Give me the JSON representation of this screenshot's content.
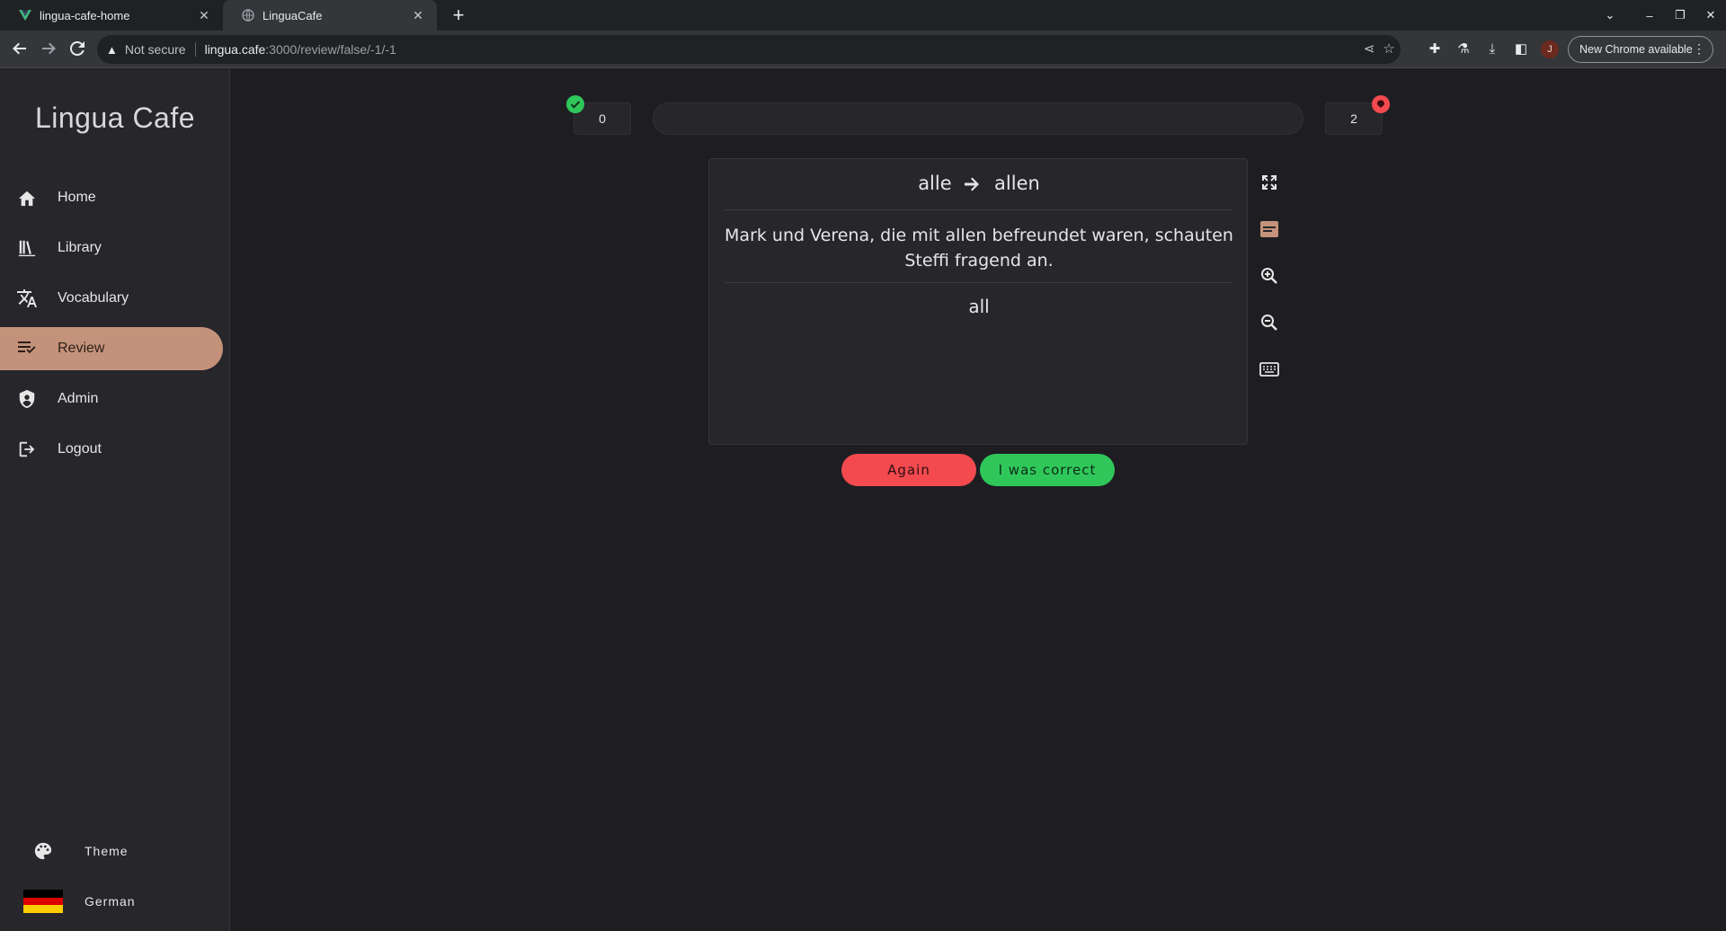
{
  "browser": {
    "tabs": [
      {
        "title": "lingua-cafe-home",
        "active": false
      },
      {
        "title": "LinguaCafe",
        "active": true
      }
    ],
    "security_label": "Not secure",
    "url_host": "lingua.cafe",
    "url_path": ":3000/review/false/-1/-1",
    "profile_initial": "J",
    "update_button": "New Chrome available"
  },
  "sidebar": {
    "brand": "Lingua Cafe",
    "items": [
      {
        "label": "Home",
        "icon": "home-icon",
        "active": false
      },
      {
        "label": "Library",
        "icon": "library-icon",
        "active": false
      },
      {
        "label": "Vocabulary",
        "icon": "translate-icon",
        "active": false
      },
      {
        "label": "Review",
        "icon": "review-icon",
        "active": true
      },
      {
        "label": "Admin",
        "icon": "shield-icon",
        "active": false
      },
      {
        "label": "Logout",
        "icon": "logout-icon",
        "active": false
      }
    ],
    "theme_label": "Theme",
    "language_label": "German"
  },
  "review": {
    "correct_count": "0",
    "incorrect_count": "2",
    "progress_fraction": 0,
    "card": {
      "base_word": "alle",
      "inflected_word": "allen",
      "sentence": "Mark und Verena, die mit allen befreundet waren, schauten Steffi fragend an.",
      "translation": "all"
    },
    "again_label": "Again",
    "correct_label": "I was correct"
  },
  "colors": {
    "accent": "#c4927a",
    "again": "#f24a4f",
    "correct": "#2fc75a",
    "background": "#1e1e22",
    "surface": "#26262b"
  }
}
